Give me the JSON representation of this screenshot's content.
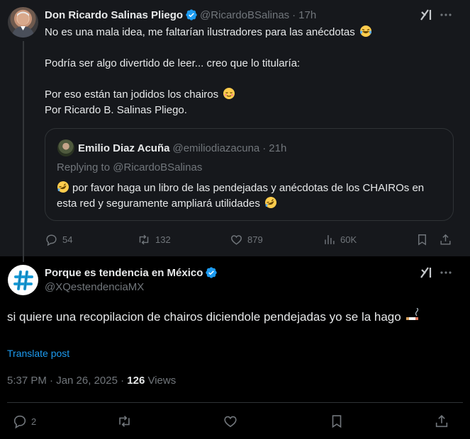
{
  "parent_tweet": {
    "author_name": "Don Ricardo Salinas Pliego",
    "handle": "@RicardoBSalinas",
    "time": "17h",
    "lines": [
      "No es una mala idea, me faltarían ilustradores para las anécdotas",
      "Podría ser algo divertido de leer... creo que lo titularía:",
      "Por eso están tan jodidos los chairos",
      "Por Ricardo B. Salinas Pliego."
    ],
    "quote": {
      "author_name": "Emilio Diaz Acuña",
      "handle": "@emiliodiazacuna",
      "time": "21h",
      "replying_to": "Replying to @RicardoBSalinas",
      "text": "por favor haga un libro de las pendejadas y anécdotas de los CHAIROs en esta red y seguramente ampliará utilidades"
    },
    "stats": {
      "replies": "54",
      "reposts": "132",
      "likes": "879",
      "views": "60K"
    }
  },
  "main_tweet": {
    "author_name": "Porque es tendencia en México",
    "handle": "@XQestendenciaMX",
    "text": "si quiere una recopilacion de chairos diciendole pendejadas yo se la hago",
    "translate_label": "Translate post",
    "timestamp": "5:37 PM · Jan 26, 2025 · ",
    "views_count": "126",
    "views_label": " Views",
    "stats": {
      "replies": "2"
    }
  },
  "icons": {
    "verified": "verified-badge-icon",
    "grok": "grok-icon",
    "more": "more-icon",
    "reply": "reply-icon",
    "repost": "repost-icon",
    "like": "like-icon",
    "views": "views-icon",
    "bookmark": "bookmark-icon",
    "share": "share-icon"
  },
  "colors": {
    "background": "#000000",
    "parent_background": "#16181c",
    "text": "#e7e9ea",
    "muted": "#71767b",
    "accent": "#1d9bf0",
    "border": "#2f3336"
  }
}
